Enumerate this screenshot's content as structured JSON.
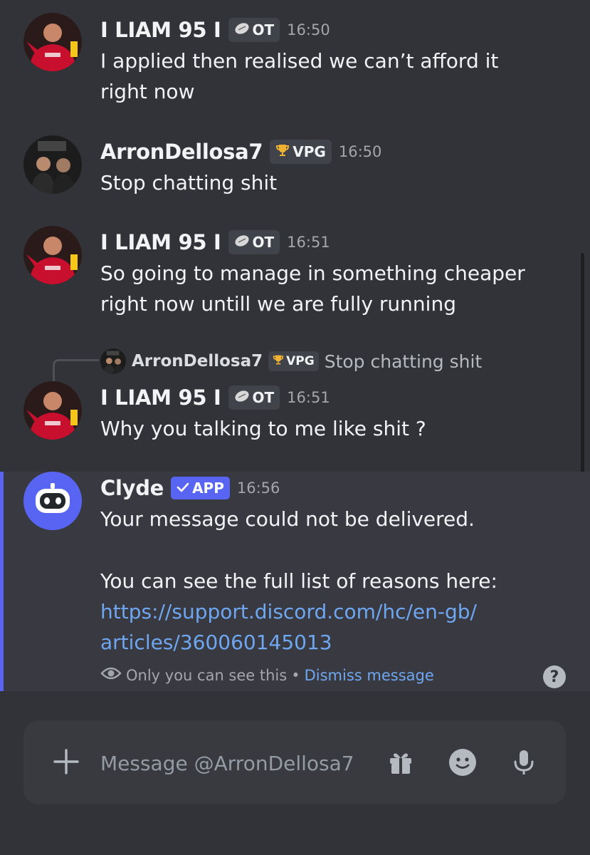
{
  "messages": [
    {
      "author": "I LIAM 95 I",
      "tag": "OT",
      "time": "16:50",
      "text": "I applied then realised we can’t afford it right now"
    },
    {
      "author": "ArronDellosa7",
      "tag": "VPG",
      "time": "16:50",
      "text": "Stop chatting shit"
    },
    {
      "author": "I LIAM 95 I",
      "tag": "OT",
      "time": "16:51",
      "text": "So going to manage in something cheaper right now untill we are fully running"
    },
    {
      "author": "I LIAM 95 I",
      "tag": "OT",
      "time": "16:51",
      "text": "Why you talking to me like shit ?",
      "reply": {
        "author": "ArronDellosa7",
        "tag": "VPG",
        "text": "Stop chatting shit"
      }
    }
  ],
  "clyde": {
    "author": "Clyde",
    "tag": "APP",
    "time": "16:56",
    "line1": "Your message could not be delivered.",
    "line2": "You can see the full list of reasons here:",
    "link": "https://support.discord.com/hc/en-gb/articles/360060145013",
    "link_part1": "https://support.discord.com/hc/en-gb/",
    "link_part2": "articles/360060145013",
    "ephemeral_text": "Only you can see this",
    "separator": "•",
    "dismiss_label": "Dismiss message",
    "help": "?"
  },
  "composer": {
    "placeholder": "Message @ArronDellosa7"
  },
  "icons": {
    "ot_tag": "football-icon",
    "vpg_tag": "trophy-icon",
    "app_tag": "checkmark-icon",
    "ephemeral": "eye-icon",
    "help": "question-icon",
    "add": "plus-icon",
    "gift": "gift-icon",
    "emoji": "emoji-icon",
    "mic": "microphone-icon"
  },
  "colors": {
    "background": "#313338",
    "highlight": "#393a41",
    "accent": "#5865f2",
    "link": "#6ea7f0"
  }
}
